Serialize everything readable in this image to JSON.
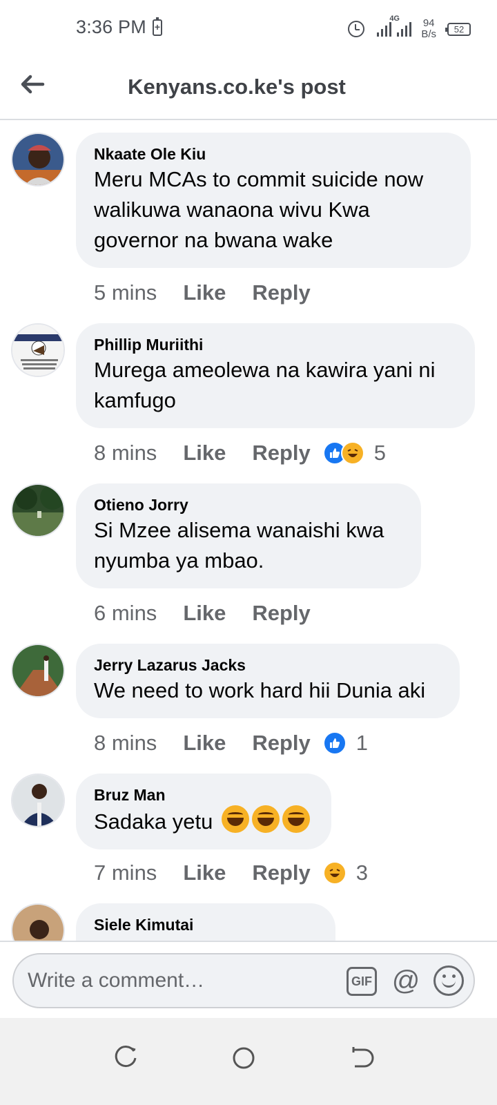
{
  "status_bar": {
    "time": "3:36 PM",
    "network_type": "4G",
    "speed_value": "94",
    "speed_unit": "B/s",
    "battery": "52"
  },
  "header": {
    "title": "Kenyans.co.ke's post"
  },
  "comments": [
    {
      "author": "Nkaate Ole Kiu",
      "text": "Meru MCAs to commit suicide now walikuwa wanaona wivu Kwa governor na bwana wake",
      "time": "5 mins",
      "like_label": "Like",
      "reply_label": "Reply"
    },
    {
      "author": "Phillip Muriithi",
      "text": "Murega ameolewa na kawira yani ni kamfugo",
      "time": "8 mins",
      "like_label": "Like",
      "reply_label": "Reply",
      "reactions": [
        "like",
        "haha"
      ],
      "reaction_count": "5"
    },
    {
      "author": "Otieno Jorry",
      "text": "Si Mzee alisema wanaishi kwa nyumba ya mbao.",
      "time": "6 mins",
      "like_label": "Like",
      "reply_label": "Reply"
    },
    {
      "author": "Jerry Lazarus Jacks",
      "text": "We need to work hard hii Dunia aki",
      "time": "8 mins",
      "like_label": "Like",
      "reply_label": "Reply",
      "reactions": [
        "like"
      ],
      "reaction_count": "1"
    },
    {
      "author": "Bruz Man",
      "text": "Sadaka yetu",
      "emoji_count": 3,
      "time": "7 mins",
      "like_label": "Like",
      "reply_label": "Reply",
      "reactions": [
        "haha"
      ],
      "reaction_count": "3"
    },
    {
      "author": "Siele Kimutai"
    }
  ],
  "composer": {
    "placeholder": "Write a comment…",
    "gif_label": "GIF",
    "mention_label": "@"
  },
  "colors": {
    "accent": "#1877f2",
    "bubble": "#f0f2f5",
    "secondary_text": "#65676b",
    "haha_yellow": "#f7b125"
  },
  "icons": [
    "back-arrow-icon",
    "alarm-icon",
    "signal-icon",
    "battery-icon",
    "like-reaction-icon",
    "haha-reaction-icon",
    "gif-icon",
    "mention-icon",
    "emoji-icon",
    "recent-apps-icon",
    "home-icon",
    "back-nav-icon"
  ]
}
